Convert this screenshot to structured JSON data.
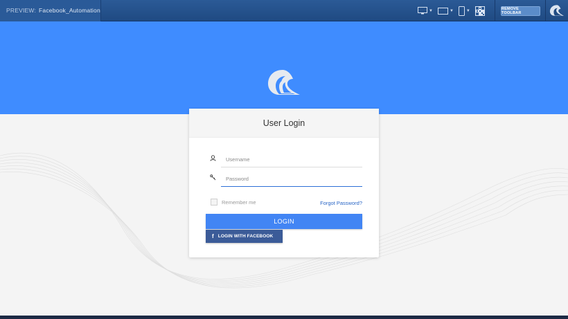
{
  "toolbar": {
    "preview_label": "PREVIEW:",
    "preview_name": "Facebook_Automation",
    "devices": [
      "desktop-icon",
      "tablet-icon",
      "phone-icon",
      "qr-code-icon"
    ],
    "remove_toolbar_label": "REMOVE TOOLBAR"
  },
  "colors": {
    "toolbar": "#1f4a82",
    "hero": "#3f8cff",
    "primary_button": "#4285f4",
    "facebook_button": "#3b5b98",
    "link": "#2b67c6"
  },
  "login": {
    "title": "User Login",
    "username_placeholder": "Username",
    "password_placeholder": "Password",
    "remember_label": "Remember me",
    "remember_checked": false,
    "forgot_label": "Forgot Password?",
    "login_label": "LOGIN",
    "facebook_icon": "f",
    "facebook_label": "LOGIN WITH FACEBOOK"
  }
}
